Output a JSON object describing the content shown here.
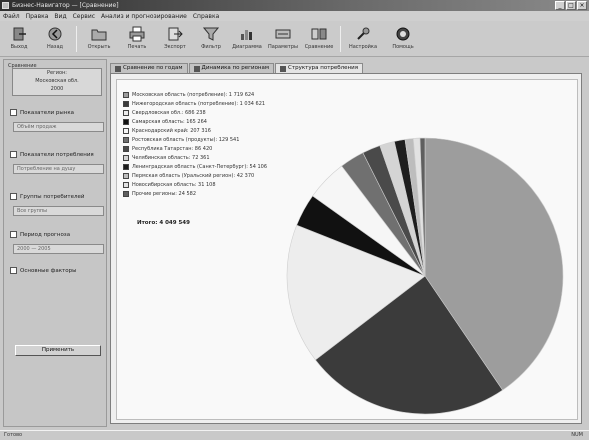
{
  "window": {
    "title": "Бизнес-Навигатор — [Сравнение]",
    "buttons": [
      "_",
      "□",
      "×"
    ]
  },
  "menu": [
    "Файл",
    "Правка",
    "Вид",
    "Сервис",
    "Анализ и прогнозирование",
    "Справка"
  ],
  "toolbar": [
    {
      "label": "Выход",
      "icon": "exit-icon"
    },
    {
      "label": "Назад",
      "icon": "back-icon"
    },
    {
      "label": "Открыть",
      "icon": "open-icon"
    },
    {
      "label": "Печать",
      "icon": "print-icon"
    },
    {
      "label": "Экспорт",
      "icon": "export-icon"
    },
    {
      "label": "Фильтр",
      "icon": "filter-icon"
    },
    {
      "label": "Диаграмма",
      "icon": "chart-icon"
    },
    {
      "label": "Параметры",
      "icon": "settings-icon"
    },
    {
      "label": "Сравнение",
      "icon": "compare-icon"
    },
    {
      "label": "Настройка",
      "icon": "config-icon"
    },
    {
      "label": "Помощь",
      "icon": "help-icon"
    }
  ],
  "left_panel": {
    "caption": "Сравнение",
    "box_lines": [
      "Регион:",
      "Московская обл.",
      "2000"
    ],
    "sections": [
      {
        "label": "Показатели рынка",
        "field": "Объём продаж"
      },
      {
        "label": "Показатели потребления",
        "field": "Потребление на душу"
      },
      {
        "label": "Группы потребителей",
        "field": "Все группы"
      },
      {
        "label": "Период прогноза",
        "field": "2000 — 2005"
      },
      {
        "label": "Основные факторы",
        "field": ""
      }
    ],
    "button_label": "Применить"
  },
  "tabs": [
    {
      "label": "Сравнение по годам",
      "active": false
    },
    {
      "label": "Динамика по регионам",
      "active": false
    },
    {
      "label": "Структура потребления",
      "active": true
    }
  ],
  "chart_data": {
    "type": "pie",
    "title": "",
    "total_label": "Итого: 4 049 549",
    "slices": [
      {
        "name": "Московская область (потребление): 1 719 624",
        "value": 42.0,
        "color": "#9d9d9d"
      },
      {
        "name": "Нижегородская область (потребление): 1 034 621",
        "value": 25.0,
        "color": "#3b3b3b"
      },
      {
        "name": "Свердловская обл.: 686 238",
        "value": 17.0,
        "color": "#ededed"
      },
      {
        "name": "Самарская область: 165 264",
        "value": 4.0,
        "color": "#111111"
      },
      {
        "name": "Краснодарский край: 207 316",
        "value": 5.0,
        "color": "#f6f6f6"
      },
      {
        "name": "Ростовская область (продукты): 129 541",
        "value": 3.0,
        "color": "#707070"
      },
      {
        "name": "Республика Татарстан: 86 420",
        "value": 2.2,
        "color": "#4a4a4a"
      },
      {
        "name": "Челябинская область: 72 361",
        "value": 1.8,
        "color": "#d4d4d4"
      },
      {
        "name": "Ленинградская область (Санкт-Петербург): 54 106",
        "value": 1.3,
        "color": "#1e1e1e"
      },
      {
        "name": "Пермская область (Уральский регион): 42 370",
        "value": 1.0,
        "color": "#bdbdbd"
      },
      {
        "name": "Новосибирская область: 31 108",
        "value": 0.8,
        "color": "#e2e2e2"
      },
      {
        "name": "Прочие регионы: 24 582",
        "value": 0.6,
        "color": "#5f5f5f"
      }
    ]
  },
  "status": {
    "left": "Готово",
    "right": "NUM"
  }
}
